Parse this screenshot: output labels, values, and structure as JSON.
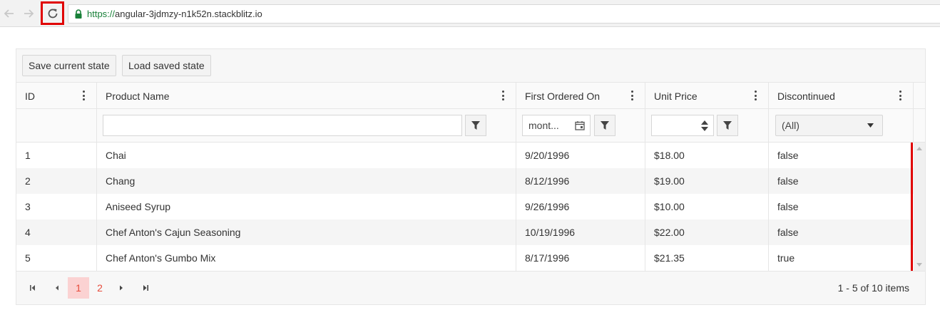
{
  "browser": {
    "url_protocol": "https://",
    "url_host": "angular-3jdmzy-n1k52n.stackblitz.io",
    "icons": {
      "back": "arrow-left-icon",
      "forward": "arrow-right-icon",
      "reload": "reload-icon",
      "lock": "lock-icon"
    }
  },
  "toolbar": {
    "save_label": "Save current state",
    "load_label": "Load saved state"
  },
  "columns": [
    {
      "title": "ID"
    },
    {
      "title": "Product Name"
    },
    {
      "title": "First Ordered On"
    },
    {
      "title": "Unit Price"
    },
    {
      "title": "Discontinued"
    }
  ],
  "filters": {
    "name_value": "",
    "date_placeholder": "mont...",
    "price_value": "",
    "discontinued_selected": "(All)"
  },
  "rows": [
    {
      "id": "1",
      "name": "Chai",
      "date": "9/20/1996",
      "price": "$18.00",
      "disc": "false"
    },
    {
      "id": "2",
      "name": "Chang",
      "date": "8/12/1996",
      "price": "$19.00",
      "disc": "false"
    },
    {
      "id": "3",
      "name": "Aniseed Syrup",
      "date": "9/26/1996",
      "price": "$10.00",
      "disc": "false"
    },
    {
      "id": "4",
      "name": "Chef Anton's Cajun Seasoning",
      "date": "10/19/1996",
      "price": "$22.00",
      "disc": "false"
    },
    {
      "id": "5",
      "name": "Chef Anton's Gumbo Mix",
      "date": "8/17/1996",
      "price": "$21.35",
      "disc": "true"
    }
  ],
  "pager": {
    "pages": [
      "1",
      "2"
    ],
    "current": "1",
    "info": "1 - 5 of 10 items"
  },
  "colors": {
    "accent": "#e74c3c",
    "highlight": "#e00000",
    "secure": "#188038"
  }
}
